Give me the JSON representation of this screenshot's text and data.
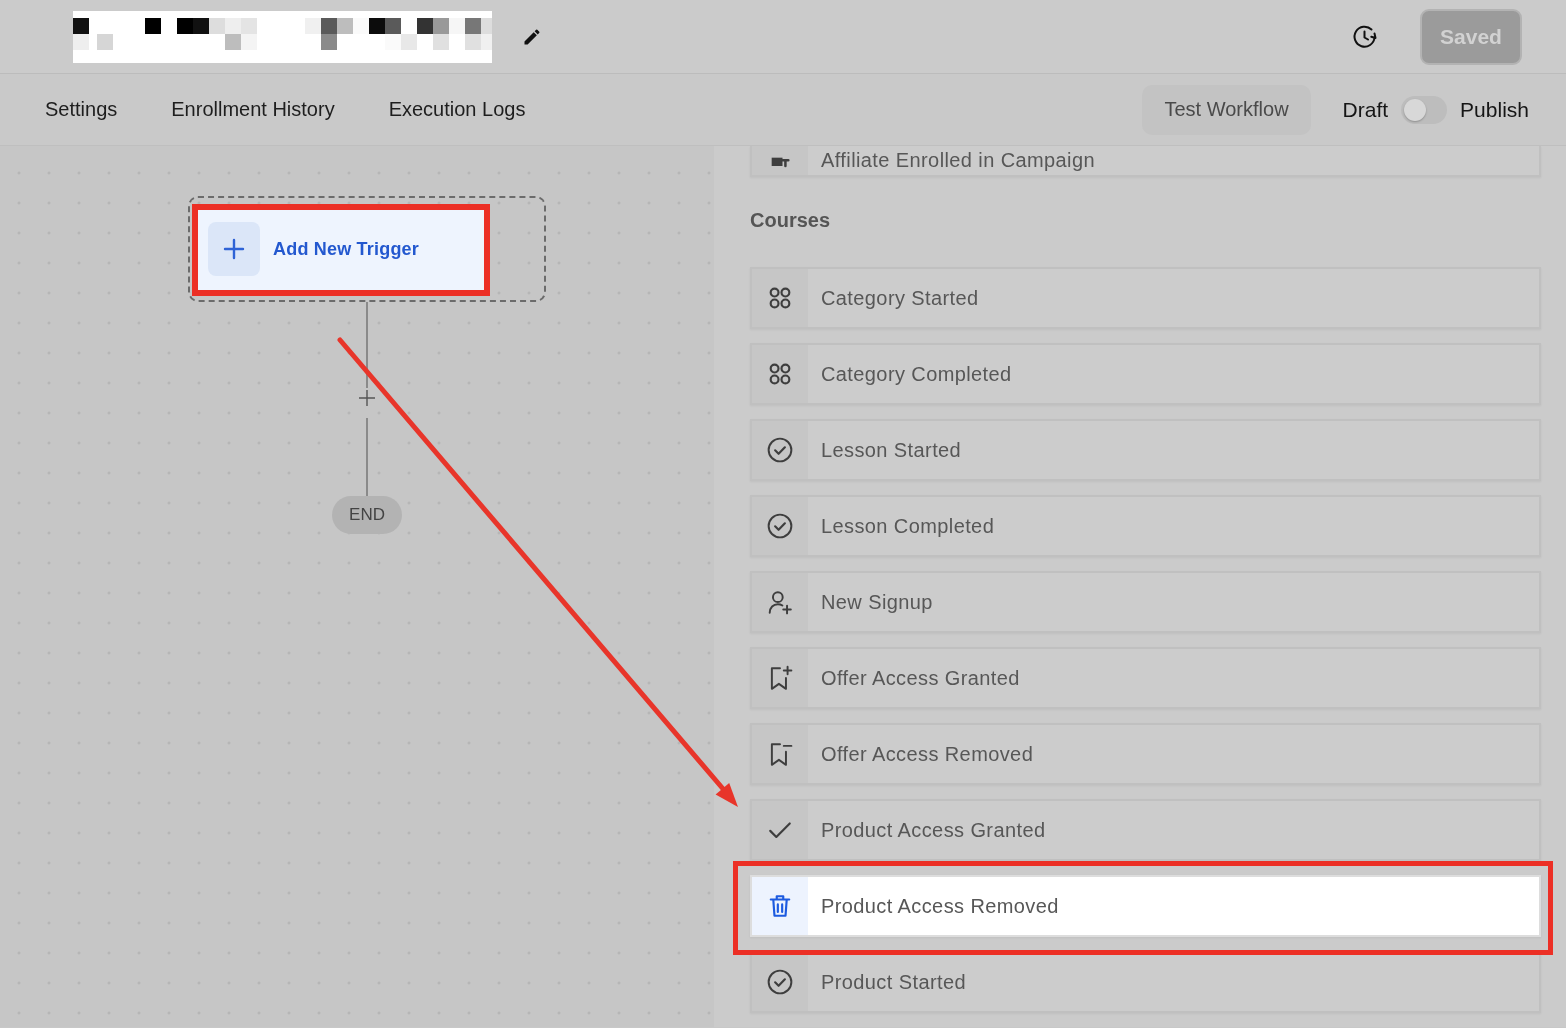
{
  "header": {
    "save_button": {
      "label": "Saved",
      "disabled": true
    }
  },
  "nav": {
    "tabs": [
      {
        "label": "Settings"
      },
      {
        "label": "Enrollment History"
      },
      {
        "label": "Execution Logs"
      }
    ],
    "test_button": {
      "label": "Test Workflow"
    },
    "status_toggle": {
      "off_label": "Draft",
      "on_label": "Publish",
      "on": false
    }
  },
  "canvas": {
    "trigger_node": {
      "label": "Add New Trigger"
    },
    "end_node": {
      "label": "END"
    }
  },
  "trigger_panel": {
    "sections": [
      {
        "items": [
          {
            "label": "Affiliate Enrolled in Campaign",
            "kind": "affiliate",
            "selected": false
          }
        ]
      },
      {
        "title": "Courses",
        "items": [
          {
            "label": "Category Started",
            "kind": "category",
            "selected": false
          },
          {
            "label": "Category Completed",
            "kind": "category",
            "selected": false
          },
          {
            "label": "Lesson Started",
            "kind": "progress",
            "selected": false
          },
          {
            "label": "Lesson Completed",
            "kind": "progress",
            "selected": false
          },
          {
            "label": "New Signup",
            "kind": "signup",
            "selected": false
          },
          {
            "label": "Offer Access Granted",
            "kind": "offergrant",
            "selected": false
          },
          {
            "label": "Offer Access Removed",
            "kind": "offerrevoke",
            "selected": false
          },
          {
            "label": "Product Access Granted",
            "kind": "grant",
            "selected": false
          },
          {
            "label": "Product Access Removed",
            "kind": "revoke",
            "selected": true
          },
          {
            "label": "Product Started",
            "kind": "progress",
            "selected": false
          }
        ]
      }
    ]
  }
}
